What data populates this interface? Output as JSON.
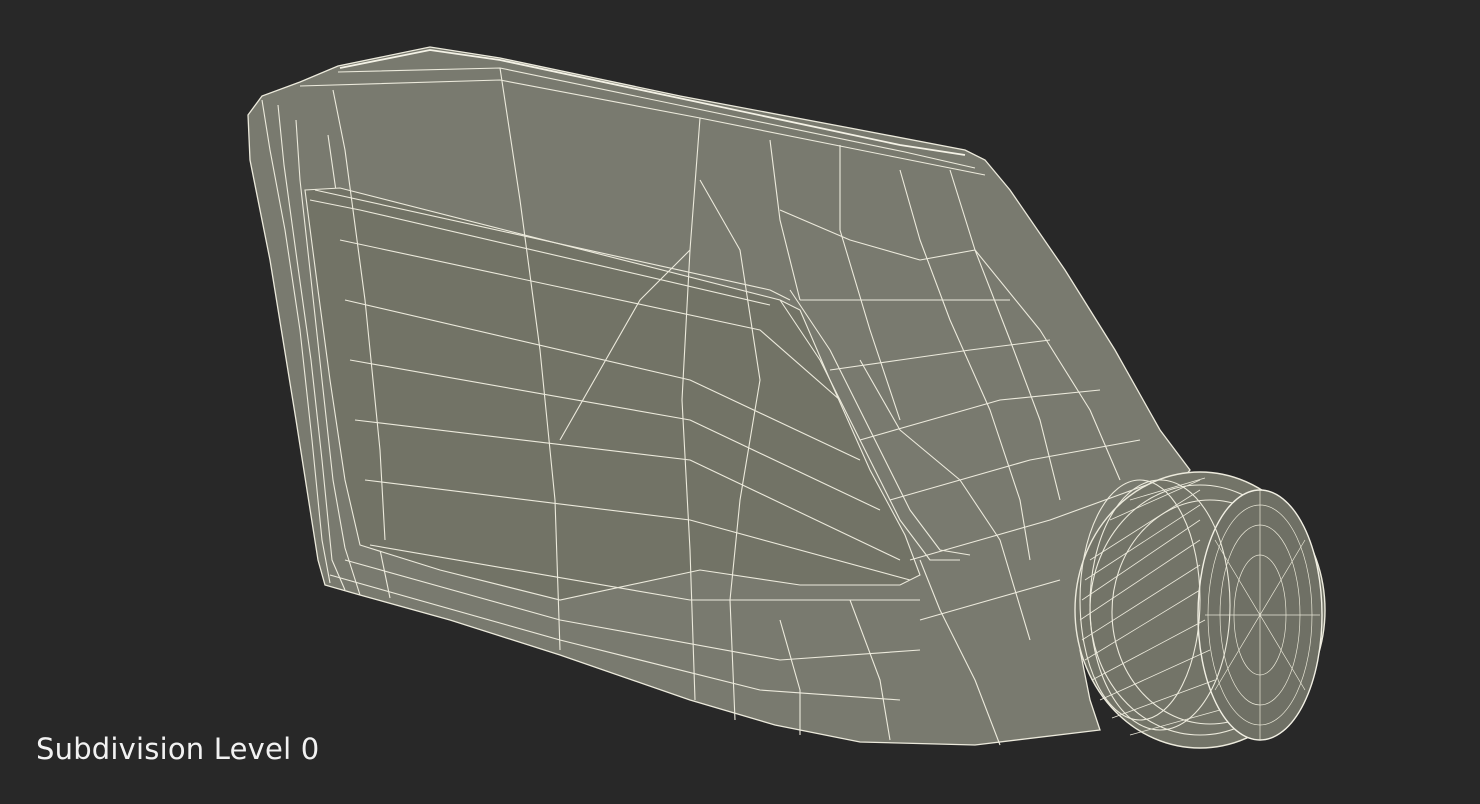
{
  "viewport": {
    "background": "#282828",
    "model_fill": "#797a6f",
    "model_fill_dark": "#707166",
    "wire_color": "#eceadc",
    "subject": "wireframe-bottle-model"
  },
  "caption": {
    "label": "Subdivision Level 0"
  }
}
